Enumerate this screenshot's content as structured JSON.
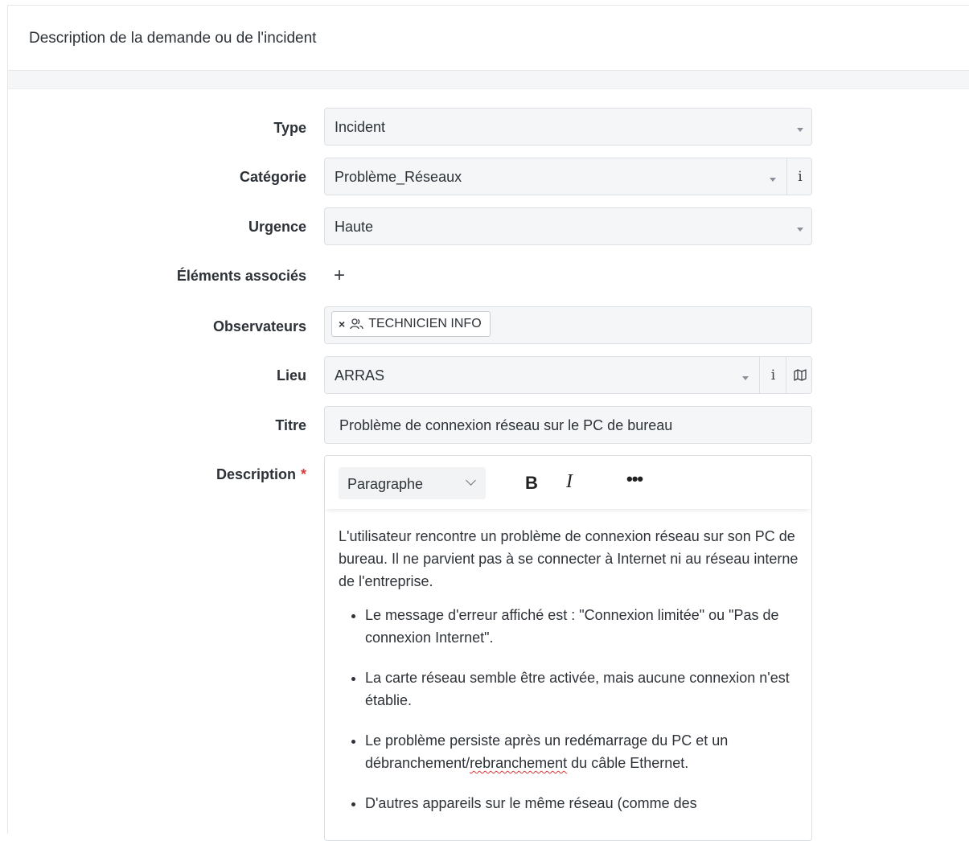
{
  "header": {
    "title": "Description de la demande ou de l'incident"
  },
  "fields": {
    "type": {
      "label": "Type",
      "value": "Incident"
    },
    "categorie": {
      "label": "Catégorie",
      "value": "Problème_Réseaux",
      "info_icon": "info-icon"
    },
    "urgence": {
      "label": "Urgence",
      "value": "Haute"
    },
    "elements_associes": {
      "label": "Éléments associés",
      "add_icon": "plus-icon"
    },
    "observateurs": {
      "label": "Observateurs",
      "tag_remove": "×",
      "tag_label": "TECHNICIEN INFO",
      "tag_icon": "group-icon"
    },
    "lieu": {
      "label": "Lieu",
      "value": "ARRAS",
      "info_icon": "info-icon",
      "map_icon": "map-icon"
    },
    "titre": {
      "label": "Titre",
      "value": "Problème de connexion réseau sur le PC de bureau"
    },
    "description": {
      "label": "Description",
      "required_mark": "*"
    }
  },
  "editor": {
    "toolbar": {
      "paragraph_select": "Paragraphe",
      "bold": "B",
      "italic": "I",
      "more": "•••"
    },
    "paragraph": "L'utilisateur rencontre un problème de connexion réseau sur son PC de bureau. Il ne parvient pas à se connecter à Internet ni au réseau interne de l'entreprise.",
    "bullets": [
      "Le message d'erreur affiché est : \"Connexion limitée\" ou \"Pas de connexion Internet\".",
      "La carte réseau semble être activée, mais aucune connexion n'est établie.",
      "D'autres appareils sur le même réseau (comme des"
    ],
    "bullet3": {
      "before": "Le problème persiste après un redémarrage du PC et un débranchement/",
      "flagged": "rebranchement",
      "after": " du câble Ethernet."
    }
  },
  "colors": {
    "required": "#d63939",
    "field_bg": "#f5f6f8",
    "border": "#dcdfe4"
  }
}
